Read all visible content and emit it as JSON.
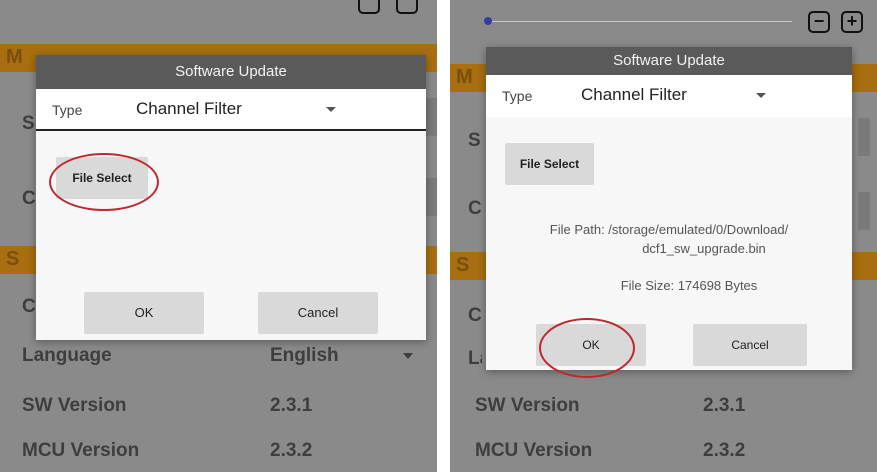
{
  "background_app": {
    "section_letter_1": "M",
    "section_letter_2": "S",
    "row_letter_1": "S",
    "row_letter_2": "C",
    "row_letter_3": "C",
    "language_label": "Language",
    "language_value": "English",
    "sw_version_label": "SW Version",
    "sw_version_value": "2.3.1",
    "mcu_version_label": "MCU Version",
    "mcu_version_value": "2.3.2"
  },
  "left_dialog": {
    "title": "Software Update",
    "type_label": "Type",
    "type_value": "Channel Filter",
    "file_select_label": "File Select",
    "ok_label": "OK",
    "cancel_label": "Cancel"
  },
  "right_dialog": {
    "title": "Software Update",
    "type_label": "Type",
    "type_value": "Channel Filter",
    "file_select_label": "File Select",
    "file_path_line1": "File Path:  /storage/emulated/0/Download/",
    "file_path_line2": "dcf1_sw_upgrade.bin",
    "file_size": "File Size:  174698 Bytes",
    "ok_label": "OK",
    "cancel_label": "Cancel"
  },
  "controls": {
    "zoom_out_symbol": "−",
    "zoom_in_symbol": "+"
  },
  "colors": {
    "highlight_oval": "#c0282d",
    "section_bar": "#a86e10",
    "dialog_title_bar": "#5a5a5a"
  }
}
